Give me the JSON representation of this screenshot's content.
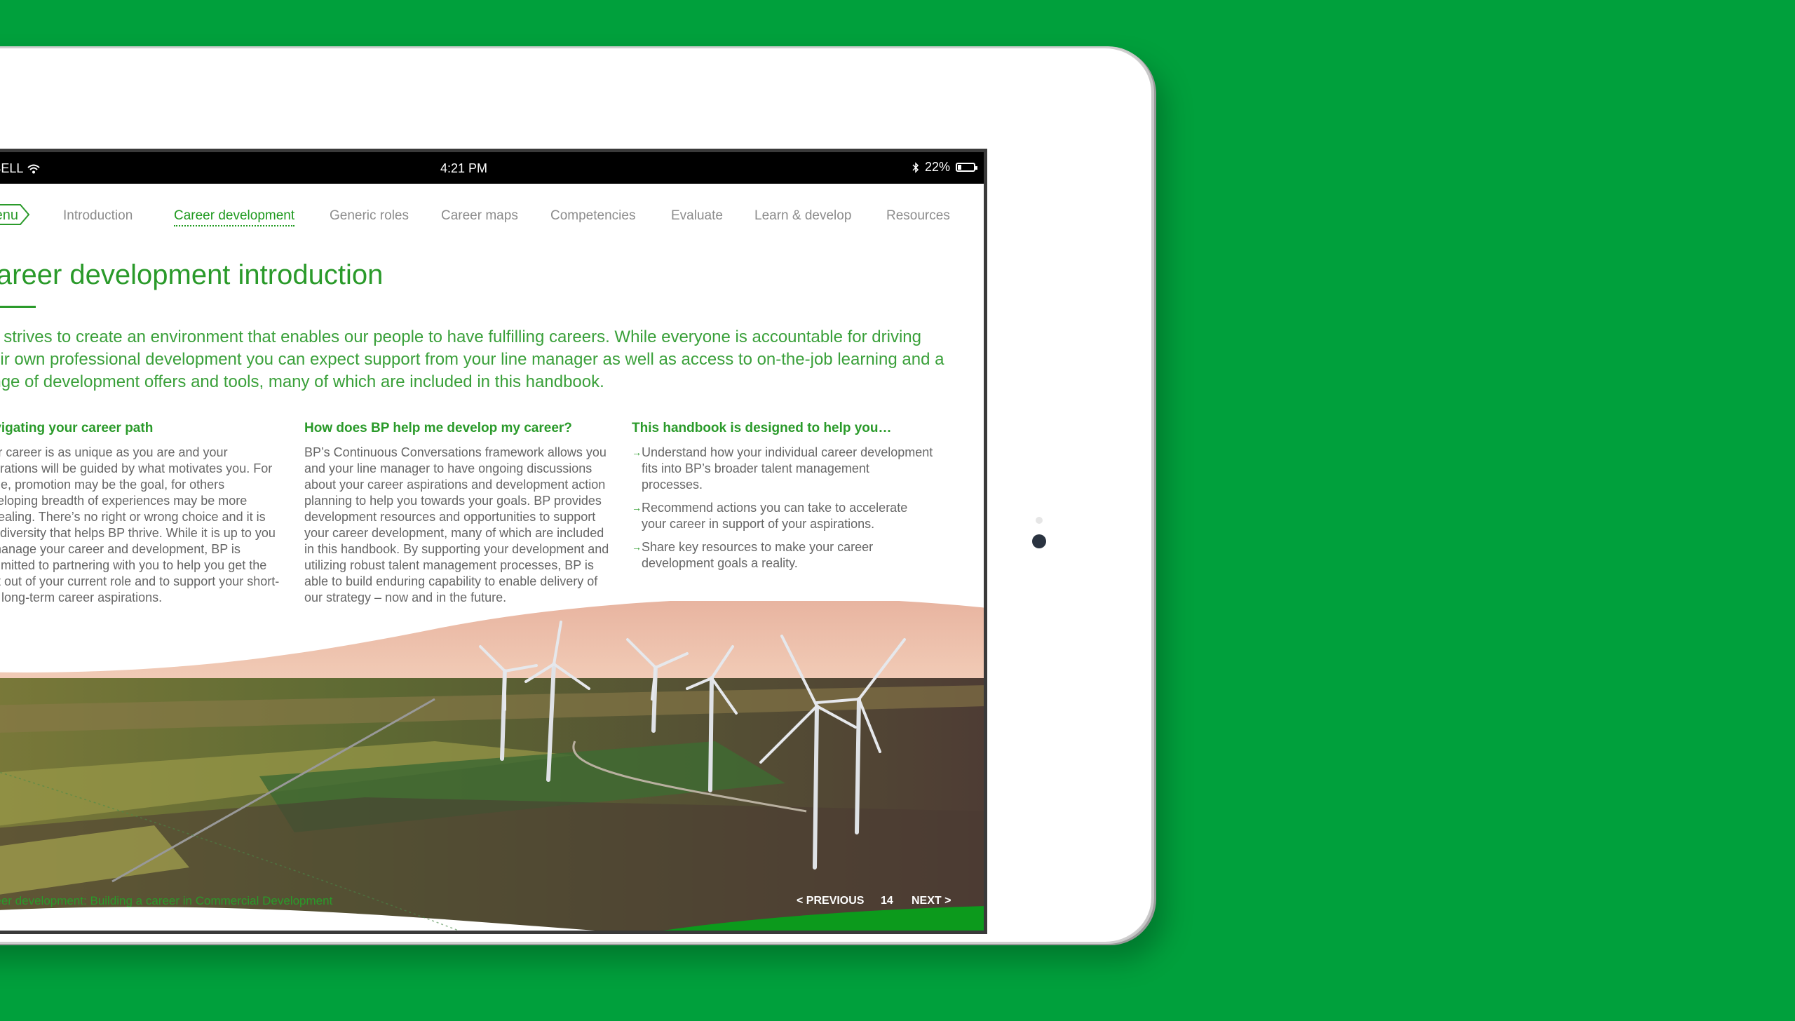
{
  "statusbar": {
    "carrier": "●●●○○ BELL",
    "time": "4:21 PM",
    "battery": "22%",
    "battery_level": 0.22
  },
  "nav": {
    "menu_label": "Menu",
    "items": [
      {
        "label": "Introduction",
        "active": false
      },
      {
        "label": "Career development",
        "active": true
      },
      {
        "label": "Generic roles",
        "active": false
      },
      {
        "label": "Career maps",
        "active": false
      },
      {
        "label": "Competencies",
        "active": false
      },
      {
        "label": "Evaluate",
        "active": false
      },
      {
        "label": "Learn & develop",
        "active": false
      },
      {
        "label": "Resources",
        "active": false
      }
    ]
  },
  "page": {
    "title": "Career development introduction",
    "intro": "BP strives to create an environment that enables our people to have fulfilling careers. While everyone is accountable for driving their own professional development you can expect support from your line manager as well as access to on-the-job learning and a range of development offers and tools, many of which are included in this handbook."
  },
  "columns": [
    {
      "heading": "Navigating your career path",
      "body": "Your career is as unique as you are and your aspirations will be guided by what motivates you. For some, promotion may be the goal, for others developing breadth of experiences may be more appealing. There’s no right or wrong choice and it is this diversity that helps BP thrive. While it is up to you to manage your career and development, BP is committed to partnering with you to help you get the best out of your current role and to support your short- and long-term career aspirations."
    },
    {
      "heading": "How does BP help me develop my career?",
      "body": "BP’s Continuous Conversations framework allows you and your line manager to have ongoing discussions about your career aspirations and development action planning to help you towards your goals. BP provides development resources and opportunities to support your career development, many of which are included in this handbook. By supporting your development and utilizing robust talent management processes, BP is able to build enduring capability to enable delivery of our strategy – now and in the future."
    },
    {
      "heading": "This handbook is designed to help you…",
      "bullets": [
        "Understand how your individual career development fits into BP’s broader talent management processes.",
        "Recommend actions you can take to accelerate your career in support of your aspirations.",
        "Share key resources to make your career development goals a reality."
      ]
    }
  ],
  "footer": {
    "caption": "Career development: Building a career in Commercial Development",
    "previous": "< PREVIOUS",
    "page_number": "14",
    "next": "NEXT >"
  },
  "colors": {
    "background": "#00a03c",
    "accent": "#2a9a2a",
    "footer_band": "#0c9a1c"
  },
  "icons": [
    "wifi-icon",
    "bluetooth-icon",
    "battery-icon",
    "bullet-arrow-icon",
    "home-indicator"
  ]
}
